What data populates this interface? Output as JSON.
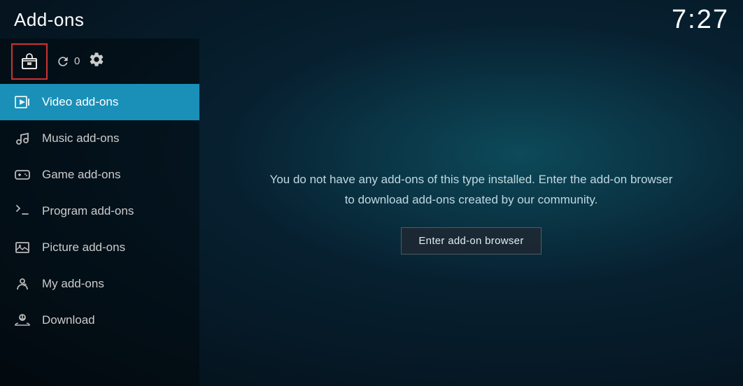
{
  "header": {
    "title": "Add-ons",
    "time": "7:27"
  },
  "toolbar": {
    "refresh_count": "0"
  },
  "sidebar": {
    "items": [
      {
        "id": "video",
        "label": "Video add-ons",
        "icon": "video-icon",
        "active": true
      },
      {
        "id": "music",
        "label": "Music add-ons",
        "icon": "music-icon",
        "active": false
      },
      {
        "id": "game",
        "label": "Game add-ons",
        "icon": "game-icon",
        "active": false
      },
      {
        "id": "program",
        "label": "Program add-ons",
        "icon": "program-icon",
        "active": false
      },
      {
        "id": "picture",
        "label": "Picture add-ons",
        "icon": "picture-icon",
        "active": false
      },
      {
        "id": "my",
        "label": "My add-ons",
        "icon": "my-addons-icon",
        "active": false
      },
      {
        "id": "download",
        "label": "Download",
        "icon": "download-icon",
        "active": false
      }
    ]
  },
  "main": {
    "empty_message": "You do not have any add-ons of this type installed. Enter the add-on browser to download add-ons created by our community.",
    "browser_button": "Enter add-on browser"
  }
}
